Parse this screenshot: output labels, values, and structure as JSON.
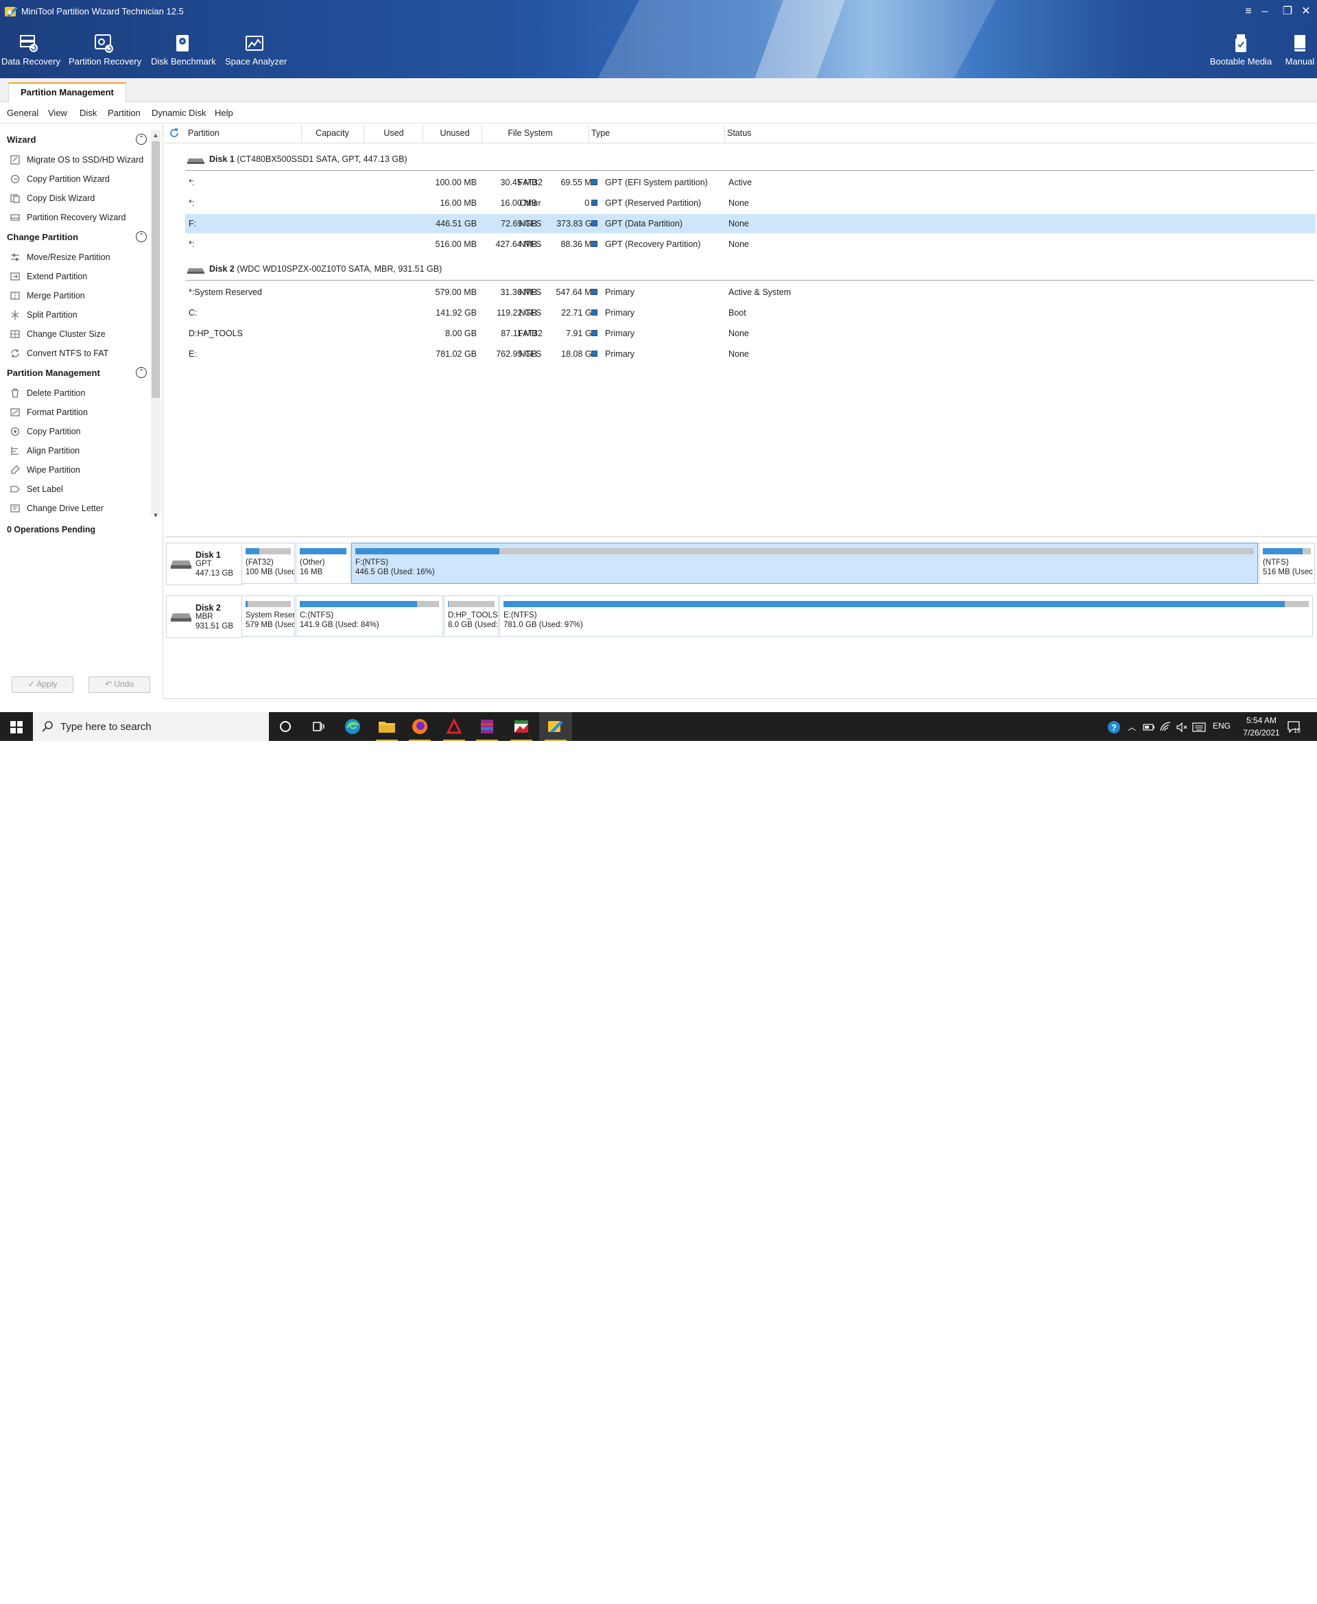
{
  "app": {
    "title": "MiniTool Partition Wizard Technician 12.5",
    "window_controls": [
      "≡",
      "–",
      "❐",
      "✕"
    ]
  },
  "toolbar": {
    "left": [
      {
        "label": "Data Recovery",
        "icon": "data-recovery-icon"
      },
      {
        "label": "Partition Recovery",
        "icon": "partition-recovery-icon"
      },
      {
        "label": "Disk Benchmark",
        "icon": "disk-benchmark-icon"
      },
      {
        "label": "Space Analyzer",
        "icon": "space-analyzer-icon"
      }
    ],
    "right": [
      {
        "label": "Bootable Media",
        "icon": "bootable-media-icon"
      },
      {
        "label": "Manual",
        "icon": "manual-icon"
      }
    ]
  },
  "tabs": [
    {
      "label": "Partition Management",
      "active": true
    }
  ],
  "menu": [
    "General",
    "View",
    "Disk",
    "Partition",
    "Dynamic Disk",
    "Help"
  ],
  "sidebar": {
    "sections": [
      {
        "title": "Wizard",
        "items": [
          "Migrate OS to SSD/HD Wizard",
          "Copy Partition Wizard",
          "Copy Disk Wizard",
          "Partition Recovery Wizard"
        ]
      },
      {
        "title": "Change Partition",
        "items": [
          "Move/Resize Partition",
          "Extend Partition",
          "Merge Partition",
          "Split Partition",
          "Change Cluster Size",
          "Convert NTFS to FAT"
        ]
      },
      {
        "title": "Partition Management",
        "items": [
          "Delete Partition",
          "Format Partition",
          "Copy Partition",
          "Align Partition",
          "Wipe Partition",
          "Set Label",
          "Change Drive Letter"
        ]
      }
    ],
    "operations_pending": "0 Operations Pending",
    "apply_label": "✓ Apply",
    "undo_label": "↶ Undo"
  },
  "table": {
    "columns": [
      "Partition",
      "Capacity",
      "Used",
      "Unused",
      "File System",
      "Type",
      "Status"
    ],
    "disks": [
      {
        "name": "Disk 1",
        "detail": "(CT480BX500SSD1 SATA, GPT, 447.13 GB)",
        "rows": [
          {
            "partition": "*:",
            "capacity": "100.00 MB",
            "used": "30.45 MB",
            "unused": "69.55 MB",
            "fs": "FAT32",
            "type": "GPT (EFI System partition)",
            "status": "Active",
            "selected": false
          },
          {
            "partition": "*:",
            "capacity": "16.00 MB",
            "used": "16.00 MB",
            "unused": "0 B",
            "fs": "Other",
            "type": "GPT (Reserved Partition)",
            "status": "None",
            "selected": false
          },
          {
            "partition": "F:",
            "capacity": "446.51 GB",
            "used": "72.69 GB",
            "unused": "373.83 GB",
            "fs": "NTFS",
            "type": "GPT (Data Partition)",
            "status": "None",
            "selected": true
          },
          {
            "partition": "*:",
            "capacity": "516.00 MB",
            "used": "427.64 MB",
            "unused": "88.36 MB",
            "fs": "NTFS",
            "type": "GPT (Recovery Partition)",
            "status": "None",
            "selected": false
          }
        ]
      },
      {
        "name": "Disk 2",
        "detail": "(WDC WD10SPZX-00Z10T0 SATA, MBR, 931.51 GB)",
        "rows": [
          {
            "partition": "*:System Reserved",
            "capacity": "579.00 MB",
            "used": "31.36 MB",
            "unused": "547.64 MB",
            "fs": "NTFS",
            "type": "Primary",
            "status": "Active & System",
            "selected": false
          },
          {
            "partition": "C:",
            "capacity": "141.92 GB",
            "used": "119.22 GB",
            "unused": "22.71 GB",
            "fs": "NTFS",
            "type": "Primary",
            "status": "Boot",
            "selected": false
          },
          {
            "partition": "D:HP_TOOLS",
            "capacity": "8.00 GB",
            "used": "87.11 MB",
            "unused": "7.91 GB",
            "fs": "FAT32",
            "type": "Primary",
            "status": "None",
            "selected": false
          },
          {
            "partition": "E:",
            "capacity": "781.02 GB",
            "used": "762.95 GB",
            "unused": "18.08 GB",
            "fs": "NTFS",
            "type": "Primary",
            "status": "None",
            "selected": false
          }
        ]
      }
    ]
  },
  "disk_map": [
    {
      "name": "Disk 1",
      "scheme": "GPT",
      "size": "447.13 GB",
      "parts": [
        {
          "l1": "(FAT32)",
          "l2": "100 MB (Used",
          "used_pct": 30,
          "selected": false
        },
        {
          "l1": "(Other)",
          "l2": "16 MB",
          "used_pct": 100,
          "selected": false
        },
        {
          "l1": "F:(NTFS)",
          "l2": "446.5 GB (Used: 16%)",
          "used_pct": 16,
          "selected": true
        },
        {
          "l1": "(NTFS)",
          "l2": "516 MB (Usec",
          "used_pct": 83,
          "selected": false
        }
      ]
    },
    {
      "name": "Disk 2",
      "scheme": "MBR",
      "size": "931.51 GB",
      "parts": [
        {
          "l1": "System Reser",
          "l2": "579 MB (Usec",
          "used_pct": 5,
          "selected": false
        },
        {
          "l1": "C:(NTFS)",
          "l2": "141.9 GB (Used: 84%)",
          "used_pct": 84,
          "selected": false
        },
        {
          "l1": "D:HP_TOOLS(",
          "l2": "8.0 GB (Used:",
          "used_pct": 1,
          "selected": false
        },
        {
          "l1": "E:(NTFS)",
          "l2": "781.0 GB (Used: 97%)",
          "used_pct": 97,
          "selected": false
        }
      ]
    }
  ],
  "taskbar": {
    "search_placeholder": "Type here to search",
    "apps": [
      "cortana-icon",
      "task-view-icon",
      "edge-icon",
      "file-explorer-icon",
      "firefox-icon",
      "acrobat-icon",
      "winrar-icon",
      "media-app-icon",
      "partition-wizard-icon"
    ],
    "tray": {
      "language": "ENG",
      "time": "5:54 AM",
      "date": "7/26/2021",
      "notification_count": "16"
    }
  },
  "colors": {
    "accent": "#3a8fd8",
    "selected_row": "#cde6fb",
    "title_bg": "#2454a2",
    "tab_highlight": "#f0a030"
  }
}
